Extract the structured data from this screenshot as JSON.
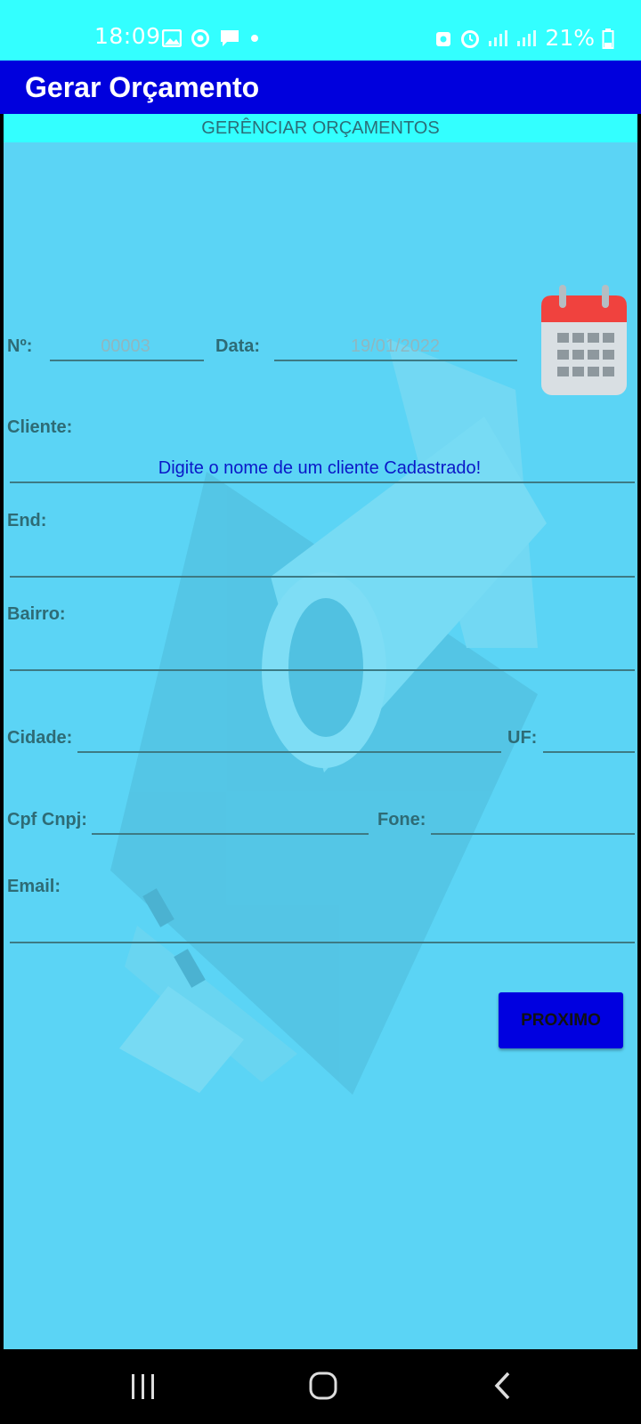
{
  "status_bar": {
    "time": "18:09",
    "battery": "21%",
    "background": "#33FFFF"
  },
  "app_bar": {
    "title": "Gerar Orçamento",
    "background": "#0000DD"
  },
  "sub_header": {
    "label": "GERÊNCIAR ORÇAMENTOS"
  },
  "form": {
    "numero_label": "Nº:",
    "numero_value": "00003",
    "data_label": "Data:",
    "data_value": "19/01/2022",
    "cliente_label": "Cliente:",
    "cliente_placeholder": "Digite o nome de um cliente Cadastrado!",
    "end_label": "End:",
    "bairro_label": "Bairro:",
    "cidade_label": "Cidade:",
    "uf_label": "UF:",
    "cpf_label": "Cpf Cnpj:",
    "fone_label": "Fone:",
    "email_label": "Email:"
  },
  "actions": {
    "next_label": "PROXIMO"
  },
  "colors": {
    "content_bg": "#5BD4F5",
    "label": "#2E6B75",
    "button": "#0000E0"
  }
}
